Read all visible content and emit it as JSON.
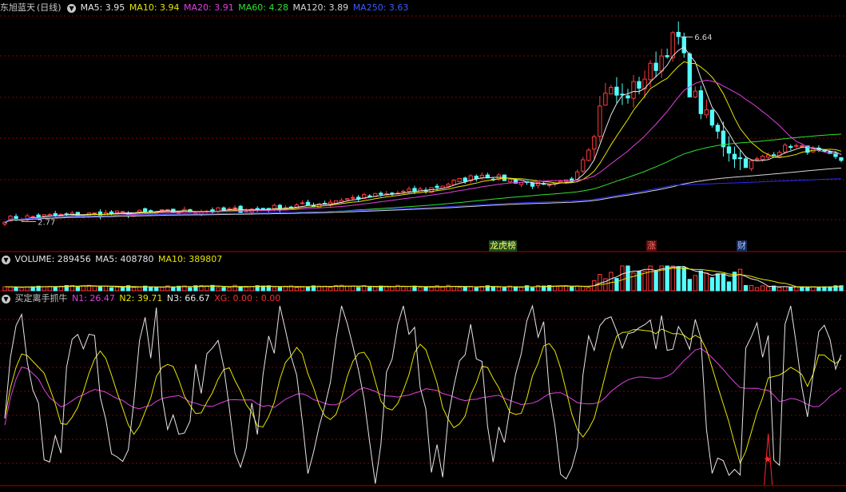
{
  "colors": {
    "up": "#ff3b3b",
    "down": "#54ffff",
    "ma5": "#e6e6e6",
    "ma10": "#e6e600",
    "ma20": "#e040e0",
    "ma60": "#33e033",
    "ma120": "#d6d6d6",
    "ma250": "#2b2bff",
    "grid": "#8a0000",
    "xg": "#ff2a2a"
  },
  "price_panel": {
    "stock_name": "东旭蓝天",
    "period": "(日线)",
    "ma5_label": "MA5: 3.95",
    "ma10_label": "MA10: 3.94",
    "ma20_label": "MA20: 3.91",
    "ma60_label": "MA60: 4.28",
    "ma120_label": "MA120: 3.89",
    "ma250_label": "MA250: 3.63",
    "high_label": "6.64",
    "low_label": "2.77",
    "event_tags": [
      "龙虎榜",
      "涨",
      "财"
    ]
  },
  "volume_panel": {
    "volume_label": "VOLUME: 289456",
    "ma5_label": "MA5: 408780",
    "ma10_label": "MA10: 389807"
  },
  "indicator_panel": {
    "name": "买定离手抓牛",
    "n1_label": "N1: 26.47",
    "n2_label": "N2: 39.71",
    "n3_label": "N3: 66.67",
    "xg_label": "XG: 0.00 : 0.00"
  },
  "chart_data": [
    {
      "type": "candlestick",
      "title": "东旭蓝天 (日线)",
      "ylim": [
        2.5,
        7.0
      ],
      "price_max": 6.64,
      "price_min": 2.77,
      "series": [
        {
          "name": "MA5",
          "value": 3.95
        },
        {
          "name": "MA10",
          "value": 3.94
        },
        {
          "name": "MA20",
          "value": 3.91
        },
        {
          "name": "MA60",
          "value": 4.28
        },
        {
          "name": "MA120",
          "value": 3.89
        },
        {
          "name": "MA250",
          "value": 3.63
        }
      ]
    },
    {
      "type": "bar",
      "title": "VOLUME",
      "series": [
        {
          "name": "VOLUME",
          "value": 289456
        },
        {
          "name": "MA5",
          "value": 408780
        },
        {
          "name": "MA10",
          "value": 389807
        }
      ]
    },
    {
      "type": "line",
      "title": "买定离手抓牛",
      "ylim": [
        0,
        100
      ],
      "series": [
        {
          "name": "N1",
          "value": 26.47
        },
        {
          "name": "N2",
          "value": 39.71
        },
        {
          "name": "N3",
          "value": 66.67
        },
        {
          "name": "XG",
          "value": 0.0
        }
      ]
    }
  ]
}
